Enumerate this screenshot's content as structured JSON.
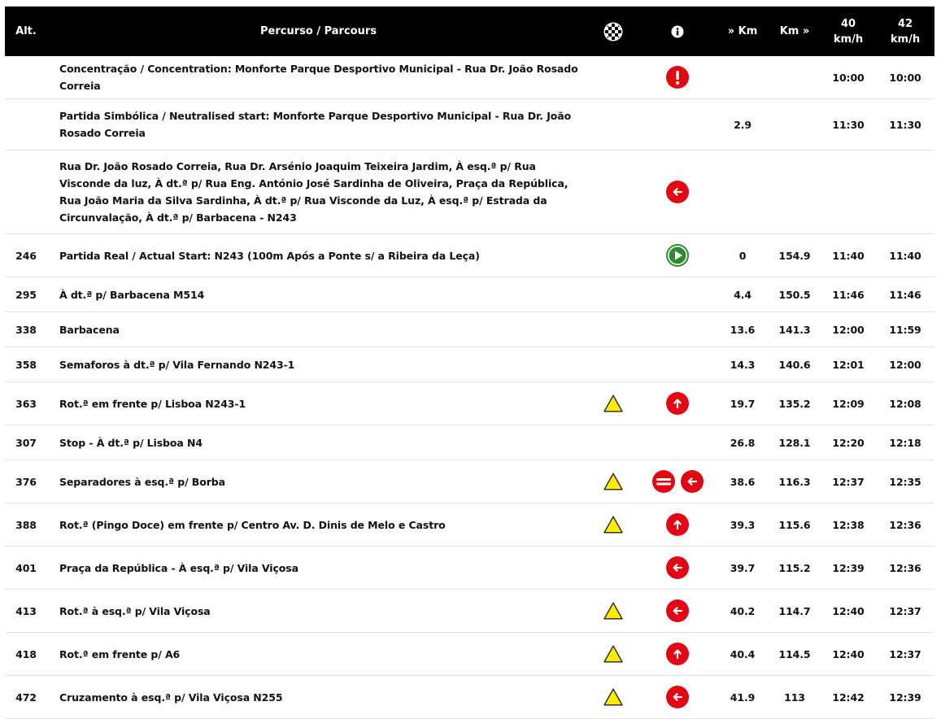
{
  "header": {
    "alt": "Alt.",
    "route": "Percurso / Parcours",
    "km_from": "» Km",
    "km_to": "Km »",
    "speed40_line1": "40",
    "speed40_line2": "km/h",
    "speed42_line1": "42",
    "speed42_line2": "km/h",
    "finish_icon": "checkered-flag-icon",
    "info_icon": "info-icon"
  },
  "colors": {
    "header_bg": "#000000",
    "accent_red": "#e30613",
    "start_green": "#2e8b2e",
    "warning_yellow": "#ffeb00"
  },
  "rows": [
    {
      "alt": "",
      "desc": "Concentração / Concentration: Monforte Parque Desportivo Municipal - Rua Dr. João Rosado Correia",
      "warning": false,
      "icons": [
        "exclamation-icon"
      ],
      "km_from": "",
      "km_to": "",
      "t40": "10:00",
      "t42": "10:00"
    },
    {
      "alt": "",
      "desc": "Partida Simbólica / Neutralised start: Monforte Parque Desportivo Municipal - Rua Dr. João Rosado Correia",
      "warning": false,
      "icons": [],
      "km_from": "2.9",
      "km_to": "",
      "t40": "11:30",
      "t42": "11:30"
    },
    {
      "alt": "",
      "desc": "Rua Dr. João Rosado Correia, Rua Dr. Arsénio Joaquim Teixeira Jardim, À esq.ª p/ Rua Visconde da luz, À dt.ª p/ Rua Eng. António José Sardinha de Oliveira, Praça da República, Rua João Maria da Silva Sardinha, À dt.ª p/ Rua Visconde da Luz, À esq.ª p/ Estrada da Circunvalação, À dt.ª p/ Barbacena - N243",
      "warning": false,
      "icons": [
        "turn-left-icon"
      ],
      "km_from": "",
      "km_to": "",
      "t40": "",
      "t42": ""
    },
    {
      "alt": "246",
      "desc": "Partida Real / Actual Start: N243 (100m Após a Ponte s/ a Ribeira da Leça)",
      "warning": false,
      "icons": [
        "start-play-icon"
      ],
      "km_from": "0",
      "km_to": "154.9",
      "t40": "11:40",
      "t42": "11:40"
    },
    {
      "alt": "295",
      "desc": "À dt.ª p/ Barbacena M514",
      "warning": false,
      "icons": [],
      "km_from": "4.4",
      "km_to": "150.5",
      "t40": "11:46",
      "t42": "11:46"
    },
    {
      "alt": "338",
      "desc": "Barbacena",
      "warning": false,
      "icons": [],
      "km_from": "13.6",
      "km_to": "141.3",
      "t40": "12:00",
      "t42": "11:59"
    },
    {
      "alt": "358",
      "desc": "Semaforos à dt.ª p/ Vila Fernando N243-1",
      "warning": false,
      "icons": [],
      "km_from": "14.3",
      "km_to": "140.6",
      "t40": "12:01",
      "t42": "12:00"
    },
    {
      "alt": "363",
      "desc": "Rot.ª em frente p/ Lisboa N243-1",
      "warning": true,
      "icons": [
        "straight-ahead-icon"
      ],
      "km_from": "19.7",
      "km_to": "135.2",
      "t40": "12:09",
      "t42": "12:08"
    },
    {
      "alt": "307",
      "desc": "Stop - À dt.ª p/ Lisboa N4",
      "warning": false,
      "icons": [],
      "km_from": "26.8",
      "km_to": "128.1",
      "t40": "12:20",
      "t42": "12:18"
    },
    {
      "alt": "376",
      "desc": "Separadores à esq.ª p/ Borba",
      "warning": true,
      "icons": [
        "separator-icon",
        "turn-left-icon"
      ],
      "km_from": "38.6",
      "km_to": "116.3",
      "t40": "12:37",
      "t42": "12:35"
    },
    {
      "alt": "388",
      "desc": "Rot.ª (Pingo Doce) em frente p/ Centro Av. D. Dinis de Melo e Castro",
      "warning": true,
      "icons": [
        "straight-ahead-icon"
      ],
      "km_from": "39.3",
      "km_to": "115.6",
      "t40": "12:38",
      "t42": "12:36"
    },
    {
      "alt": "401",
      "desc": "Praça da República - À esq.ª p/ Vila Viçosa",
      "warning": false,
      "icons": [
        "turn-left-icon"
      ],
      "km_from": "39.7",
      "km_to": "115.2",
      "t40": "12:39",
      "t42": "12:36"
    },
    {
      "alt": "413",
      "desc": "Rot.ª à esq.ª p/ Vila Viçosa",
      "warning": true,
      "icons": [
        "turn-left-icon"
      ],
      "km_from": "40.2",
      "km_to": "114.7",
      "t40": "12:40",
      "t42": "12:37"
    },
    {
      "alt": "418",
      "desc": "Rot.ª em frente p/ A6",
      "warning": true,
      "icons": [
        "straight-ahead-icon"
      ],
      "km_from": "40.4",
      "km_to": "114.5",
      "t40": "12:40",
      "t42": "12:37"
    },
    {
      "alt": "472",
      "desc": "Cruzamento à esq.ª p/ Vila Viçosa N255",
      "warning": true,
      "icons": [
        "turn-left-icon"
      ],
      "km_from": "41.9",
      "km_to": "113",
      "t40": "12:42",
      "t42": "12:39"
    }
  ]
}
